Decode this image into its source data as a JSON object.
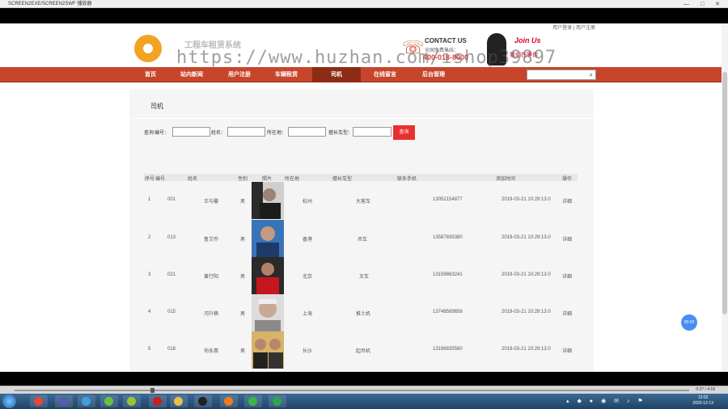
{
  "player": {
    "window_title": "SCREEN2EXE/SCREEN2SWF 播放器",
    "time_display": "0:27 / 4:18"
  },
  "site": {
    "user_links": "用户登录 | 用户注册",
    "title": "工程车租赁系统",
    "contact_title": "CONTACT US",
    "contact_sub": "全国免费热线：",
    "contact_phone": "400-018-8000",
    "join_title": "Join Us",
    "join_sub": "我们在等你",
    "watermark": "https://www.huzhan.com/ishop39897"
  },
  "nav": {
    "items": [
      {
        "label": "首页"
      },
      {
        "label": "站内新闻"
      },
      {
        "label": "用户注册"
      },
      {
        "label": "车辆租赁"
      },
      {
        "label": "司机"
      },
      {
        "label": "在线留言"
      },
      {
        "label": "后台管理"
      }
    ],
    "search_value": ""
  },
  "page": {
    "heading": "司机",
    "filters": {
      "query_label": "查询",
      "id_label": "编号：",
      "name_label": "姓名：",
      "location_label": "所在地：",
      "vehicle_label": "擅长车型：",
      "id_value": "",
      "name_value": "",
      "location_value": "",
      "vehicle_value": "",
      "query_button": "查询"
    },
    "table": {
      "headers": [
        "序号",
        "编号",
        "姓名",
        "性别",
        "照片",
        "所在地",
        "擅长车型",
        "联系手机",
        "添加时间",
        "操作"
      ],
      "rows": [
        {
          "no": "1",
          "id": "001",
          "name": "王与馨",
          "gender": "男",
          "location": "杭州",
          "vehicle": "大客车",
          "phone": "13052154877",
          "time": "2019-03-21 10:29:13.0",
          "action": "详细"
        },
        {
          "no": "2",
          "id": "013",
          "name": "鲁艾乔",
          "gender": "男",
          "location": "香港",
          "vehicle": "吊车",
          "phone": "13587835380",
          "time": "2019-03-21 10:29:13.0",
          "action": "详细"
        },
        {
          "no": "3",
          "id": "021",
          "name": "黄行阳",
          "gender": "男",
          "location": "北京",
          "vehicle": "叉车",
          "phone": "13159863241",
          "time": "2019-03-21 10:29:13.0",
          "action": "详细"
        },
        {
          "no": "4",
          "id": "015",
          "name": "河升楠",
          "gender": "男",
          "location": "上海",
          "vehicle": "推土机",
          "phone": "13748589658",
          "time": "2019-03-21 10:29:13.0",
          "action": "详细"
        },
        {
          "no": "5",
          "id": "018",
          "name": "何永惠",
          "gender": "男",
          "location": "长沙",
          "vehicle": "起吊机",
          "phone": "13186835580",
          "time": "2019-03-21 10:29:13.0",
          "action": "详细"
        }
      ]
    }
  },
  "overlay": {
    "timer": "00:20"
  },
  "taskbar": {
    "clock_time": "12:02",
    "clock_date": "2020-12-13"
  }
}
